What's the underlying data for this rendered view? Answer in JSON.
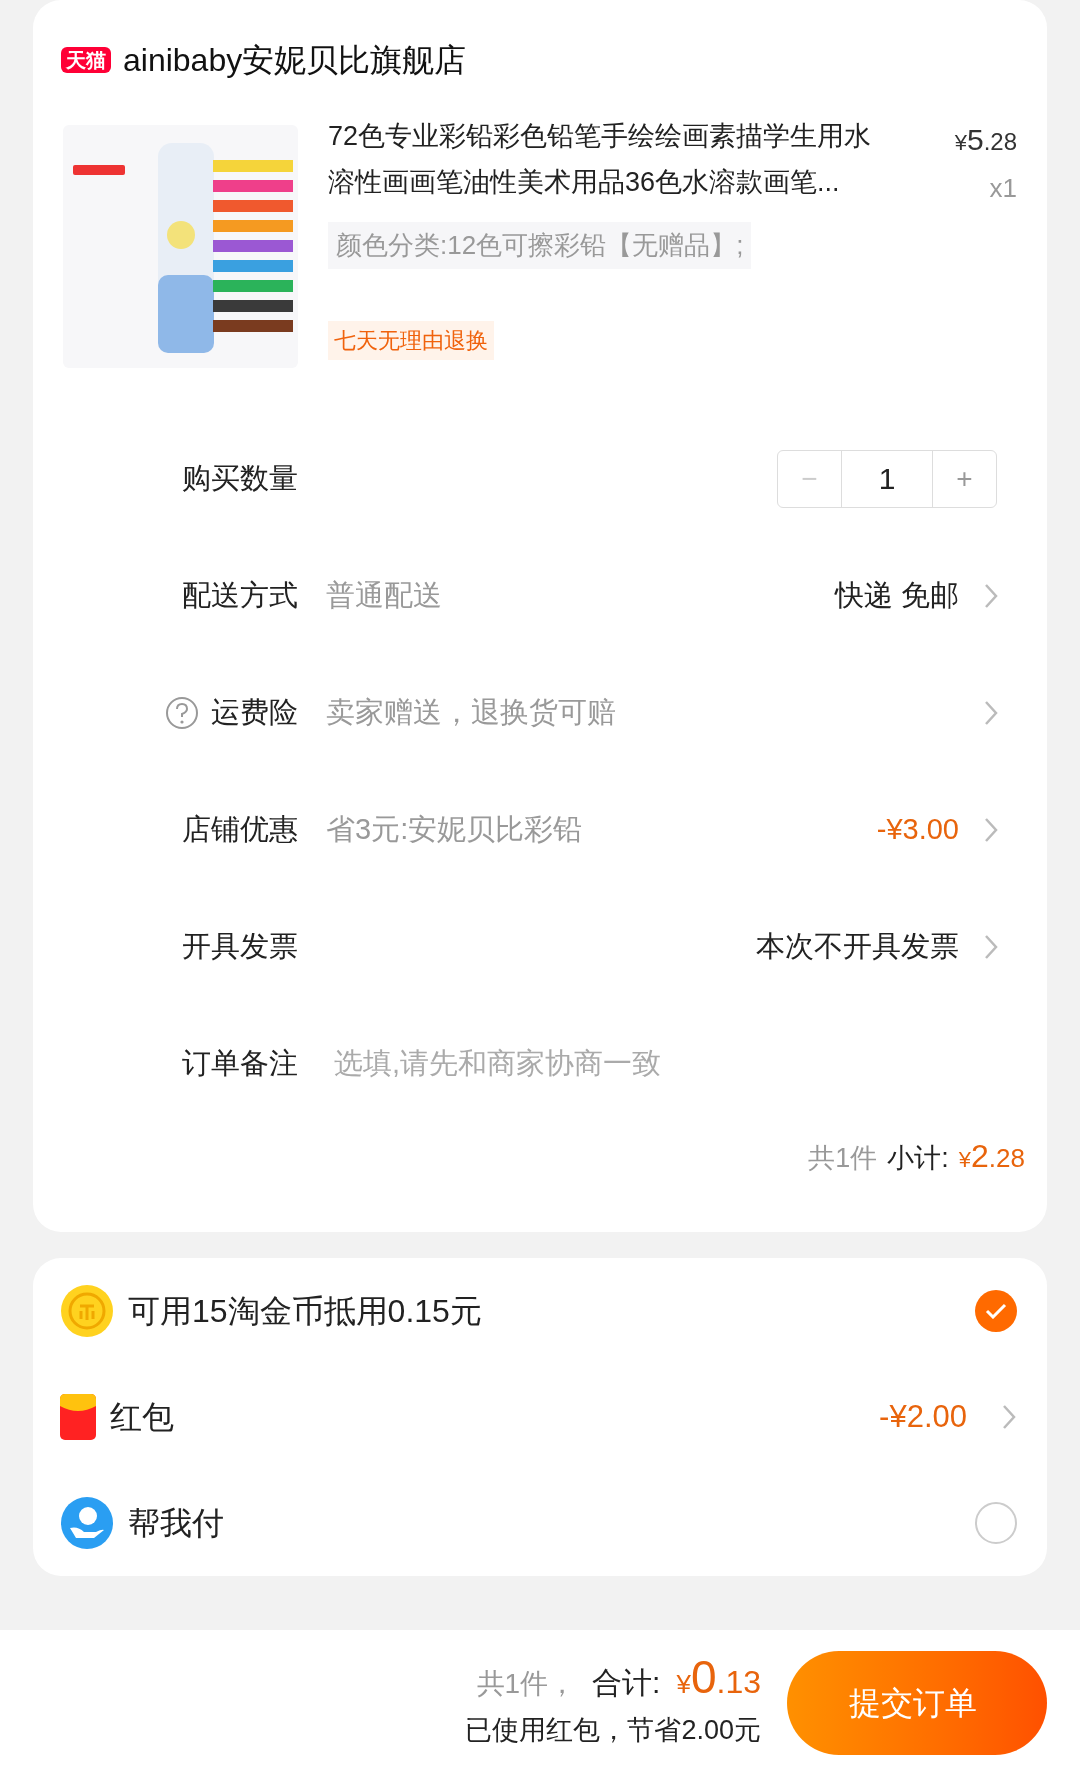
{
  "store": {
    "badge": "天猫",
    "name": "ainibaby安妮贝比旗舰店"
  },
  "product": {
    "title": "72色专业彩铅彩色铅笔手绘绘画素描学生用水溶性画画笔油性美术用品36色水溶款画笔...",
    "currency": "¥",
    "price_main": "5",
    "price_fraction": ".28",
    "quantity": "x1",
    "sku": "颜色分类:12色可擦彩铅【无赠品】;",
    "tag": "七天无理由退换"
  },
  "rows": [
    {
      "kind": "stepper",
      "label": "购买数量",
      "minus": "−",
      "value": "1",
      "plus": "+"
    },
    {
      "kind": "link",
      "label": "配送方式",
      "detail": "普通配送",
      "value": "快递 免邮"
    },
    {
      "kind": "link",
      "label": "运费险",
      "detail": "卖家赠送，退换货可赔",
      "help": true
    },
    {
      "kind": "link",
      "label": "店铺优惠",
      "detail": "省3元:安妮贝比彩铅",
      "value": "-¥3.00",
      "highlight": true
    },
    {
      "kind": "link",
      "label": "开具发票",
      "value": "本次不开具发票"
    },
    {
      "kind": "input",
      "label": "订单备注",
      "placeholder": "选填,请先和商家协商一致"
    }
  ],
  "subtotal": {
    "count": "共1件",
    "label": "小计:",
    "currency": "¥",
    "main": "2",
    "fraction": ".28"
  },
  "benefits": [
    {
      "kind": "coin",
      "text": "可用15淘金币抵用0.15元",
      "selected": true
    },
    {
      "kind": "redpacket",
      "text": "红包",
      "value": "-¥2.00"
    },
    {
      "kind": "pay",
      "text": "帮我付",
      "selected": false
    }
  ],
  "footer": {
    "count": "共1件，",
    "total_label": "合计:",
    "currency": "¥",
    "main": "0",
    "fraction": ".13",
    "saving": "已使用红包，节省2.00元",
    "submit": "提交订单"
  }
}
